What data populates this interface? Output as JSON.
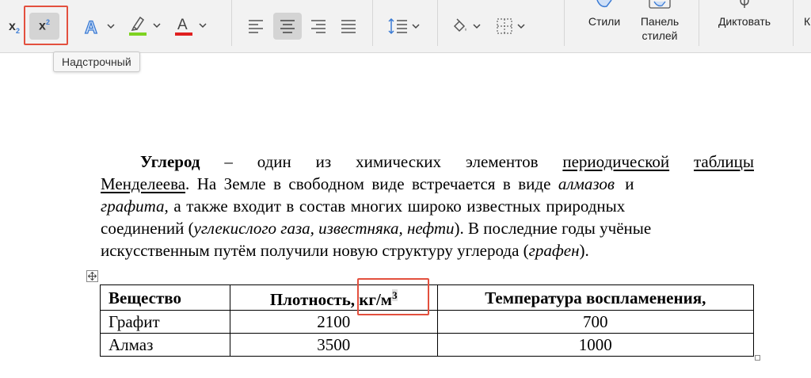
{
  "ribbon": {
    "subscript_label": "x",
    "subscript_mark": "2",
    "superscript_label": "x",
    "superscript_mark": "2",
    "styles_label": "Стили",
    "styles_pane_line1": "Панель",
    "styles_pane_line2": "стилей",
    "dictate_label": "Диктовать",
    "cut_label": "К",
    "tooltip": "Надстрочный",
    "colors": {
      "highlight": "#7ed321",
      "font_color": "#e02020",
      "text_effect": "#3b7bd4",
      "selected_bg": "#d4d4d4",
      "annotation": "#e3503e"
    }
  },
  "document": {
    "paragraph": {
      "line1": [
        "Углерод",
        "–",
        "один",
        "из",
        "химических",
        "элементов",
        "периодической",
        "таблицы"
      ],
      "line2_a": "Менделеева",
      "line2_b": ". На Земле в свободном виде встречается в виде ",
      "line2_c": "алмазов",
      "line2_d": " и",
      "line3_a": "графита",
      "line3_b": ", а также входит в состав многих широко известных природных",
      "line4_a": "соединений (",
      "line4_b": "углекислого газа, известняка, нефти",
      "line4_c": "). В последние годы учёные",
      "line5_a": "искусственным путём получили новую структуру углерода (",
      "line5_b": "графен",
      "line5_c": ")."
    },
    "table": {
      "headers": [
        "Вещество",
        "Плотность, кг/м",
        "3",
        "Температура воспламенения,"
      ],
      "rows": [
        [
          "Графит",
          "2100",
          "700"
        ],
        [
          "Алмаз",
          "3500",
          "1000"
        ]
      ]
    }
  }
}
